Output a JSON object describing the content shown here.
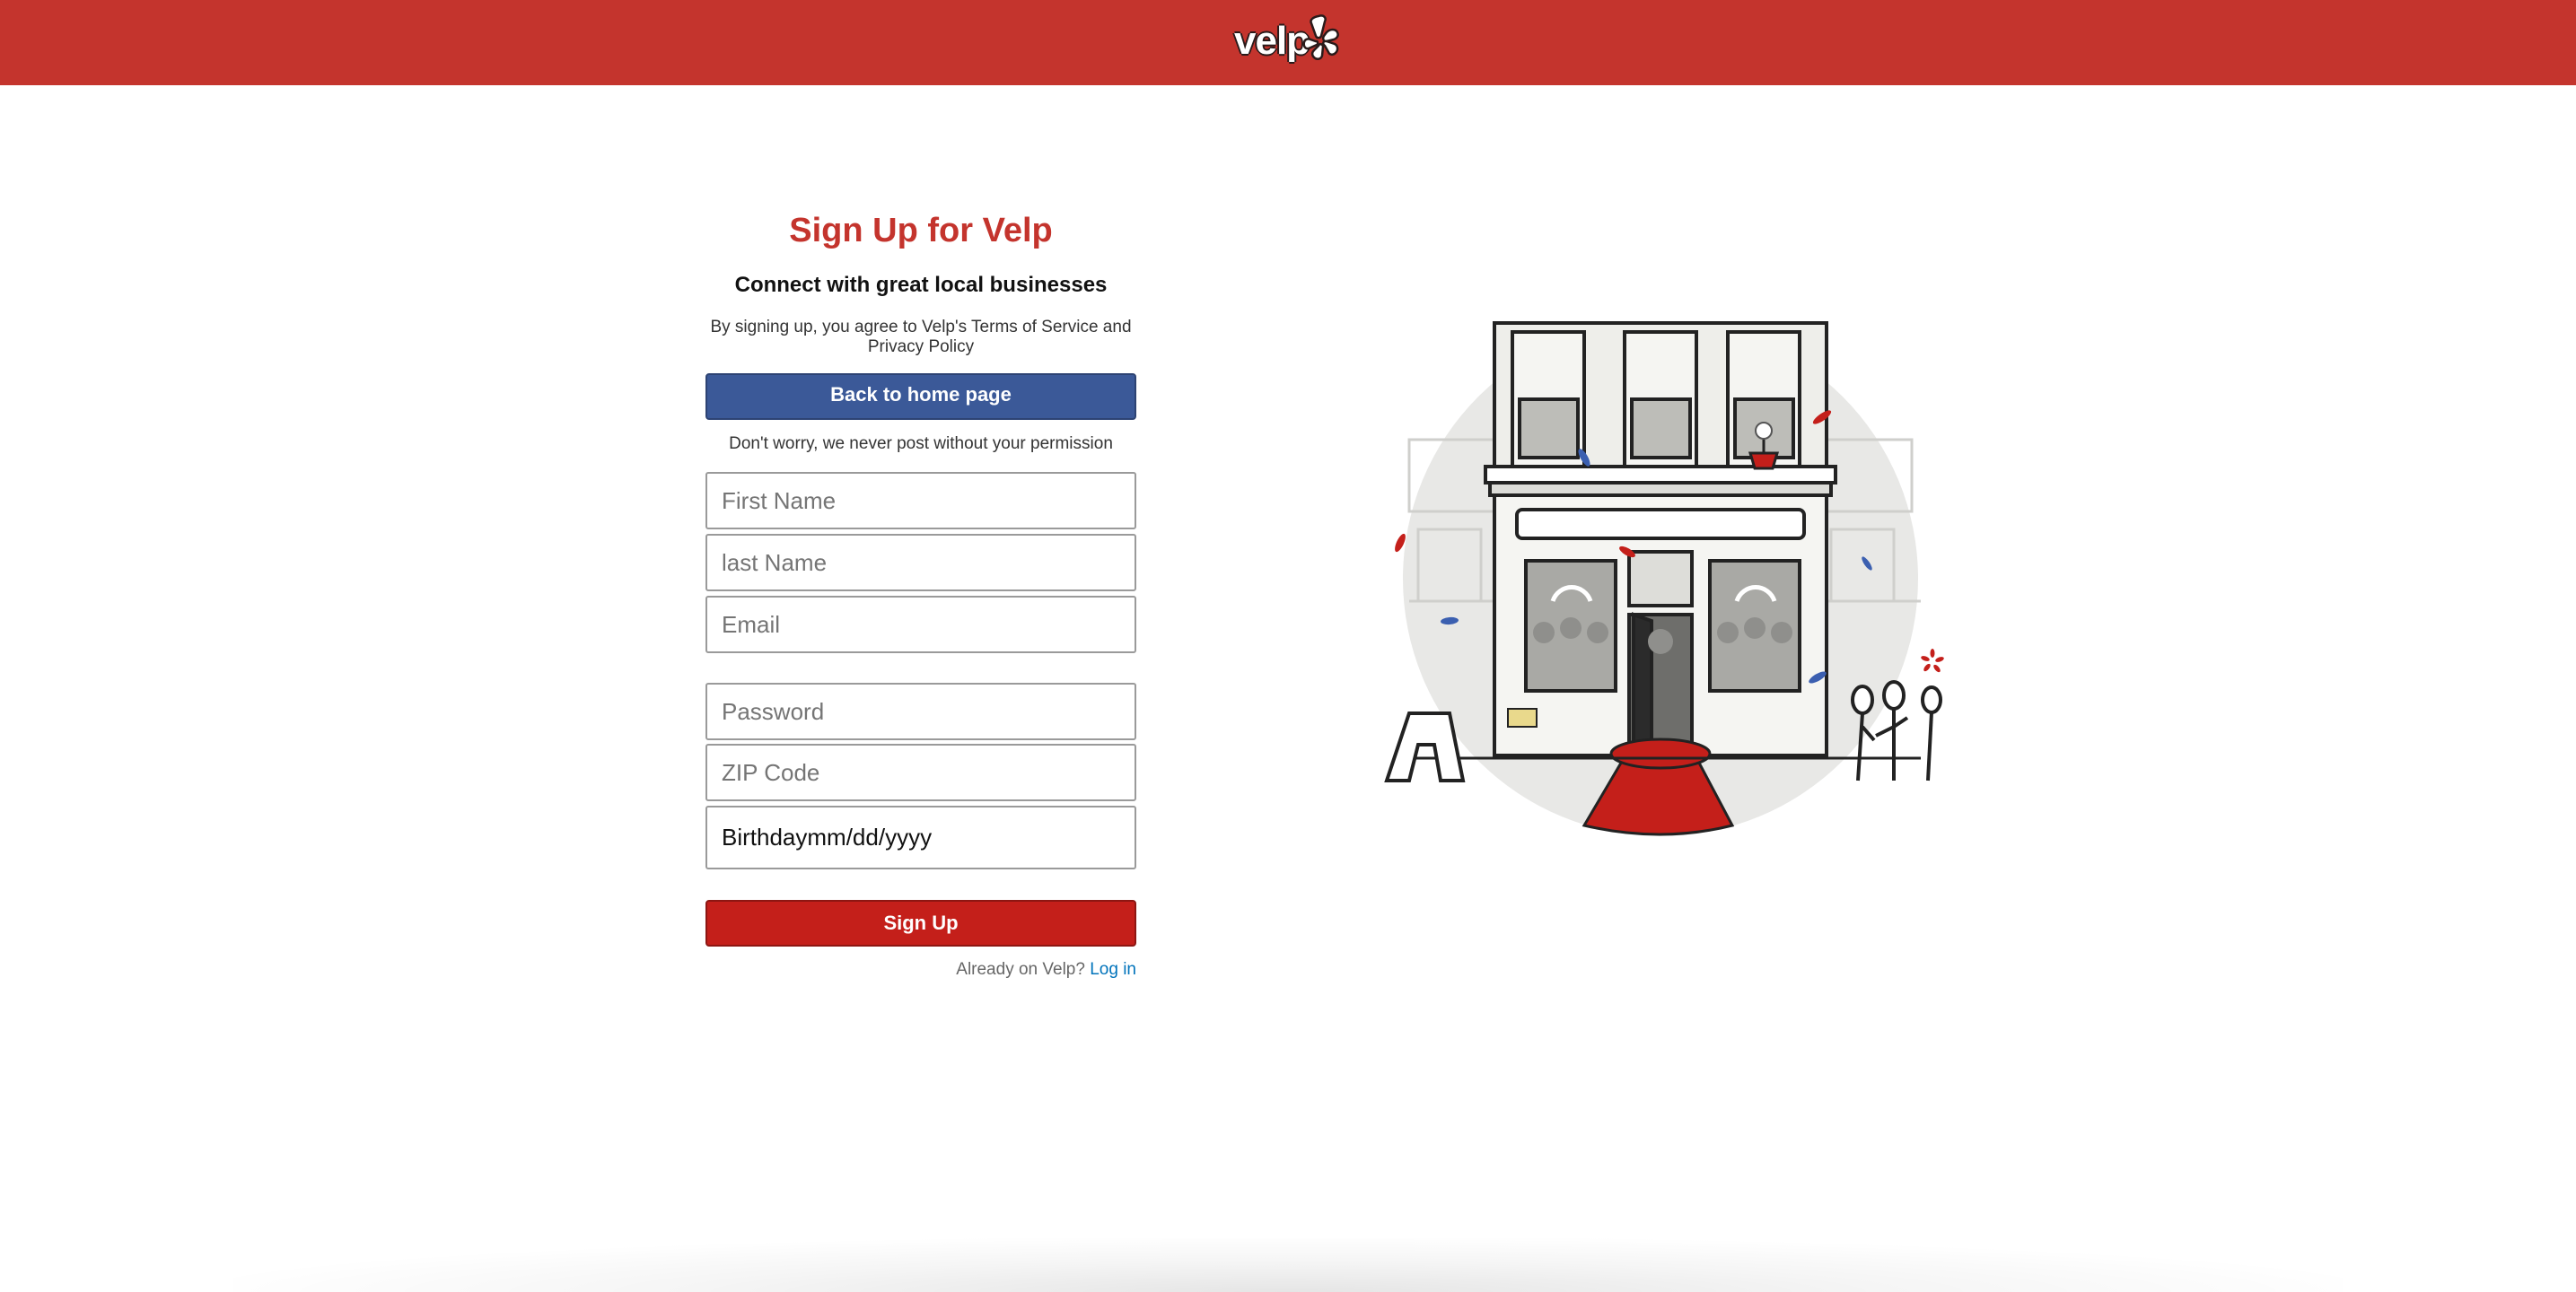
{
  "header": {
    "logo_text": "velp"
  },
  "form": {
    "title": "Sign Up for Velp",
    "subtitle": "Connect with great local businesses",
    "legal_text": "By signing up, you agree to Velp's Terms of Service and Privacy Policy",
    "home_button_label": "Back to home page",
    "permission_note": "Don't worry, we never post without your permission",
    "fields": {
      "first_name_placeholder": "First Name",
      "last_name_placeholder": "last Name",
      "email_placeholder": "Email",
      "password_placeholder": "Password",
      "zip_placeholder": "ZIP Code",
      "birthday_label": "Birthdaymm/dd/yyyy"
    },
    "signup_button_label": "Sign Up",
    "already_text": "Already on Velp?",
    "login_link_label": "Log in"
  },
  "colors": {
    "brand_red": "#c4342d",
    "facebook_blue": "#3b5998",
    "signup_red": "#c41f1a",
    "link_blue": "#0073bb"
  },
  "icons": {
    "logo_burst": "yelp-burst-icon",
    "illustration": "storefront-illustration"
  }
}
